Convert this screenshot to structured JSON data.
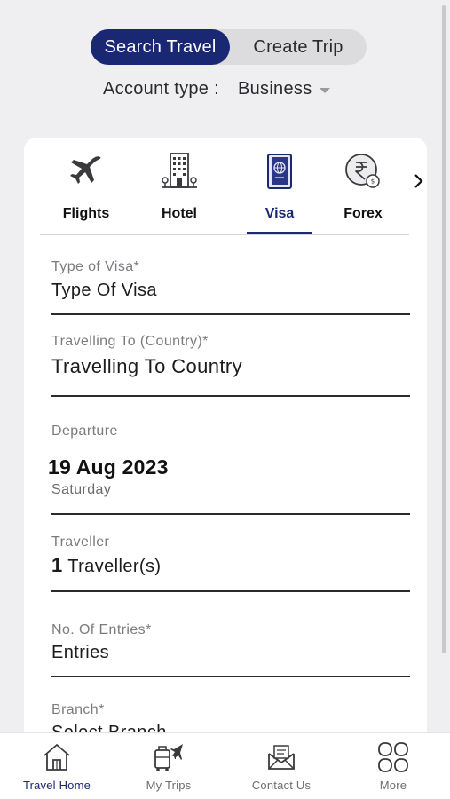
{
  "toggle": {
    "search_travel": "Search Travel",
    "create_trip": "Create Trip"
  },
  "account": {
    "label": "Account type :",
    "value": "Business"
  },
  "tabs": [
    {
      "label": "Flights",
      "icon": "airplane-icon"
    },
    {
      "label": "Hotel",
      "icon": "hotel-building-icon"
    },
    {
      "label": "Visa",
      "icon": "passport-icon",
      "active": true
    },
    {
      "label": "Forex",
      "icon": "rupee-exchange-icon"
    }
  ],
  "form": {
    "visa_type": {
      "label": "Type of Visa*",
      "value": "Type Of Visa"
    },
    "travelling_to": {
      "label": "Travelling To (Country)*",
      "value": "Travelling To Country"
    },
    "departure": {
      "label": "Departure",
      "date": "19 Aug 2023",
      "day": "Saturday"
    },
    "traveller": {
      "label": "Traveller",
      "count": "1",
      "suffix": "Traveller(s)"
    },
    "entries": {
      "label": "No. Of Entries*",
      "value": "Entries"
    },
    "branch": {
      "label": "Branch*",
      "value": "Select Branch"
    }
  },
  "bottom_nav": [
    {
      "label": "Travel Home",
      "icon": "home-icon",
      "active": true
    },
    {
      "label": "My Trips",
      "icon": "luggage-icon"
    },
    {
      "label": "Contact Us",
      "icon": "envelope-icon"
    },
    {
      "label": "More",
      "icon": "grid-icon"
    }
  ],
  "colors": {
    "brand": "#1a2873",
    "background": "#efeff1",
    "card": "#ffffff"
  }
}
